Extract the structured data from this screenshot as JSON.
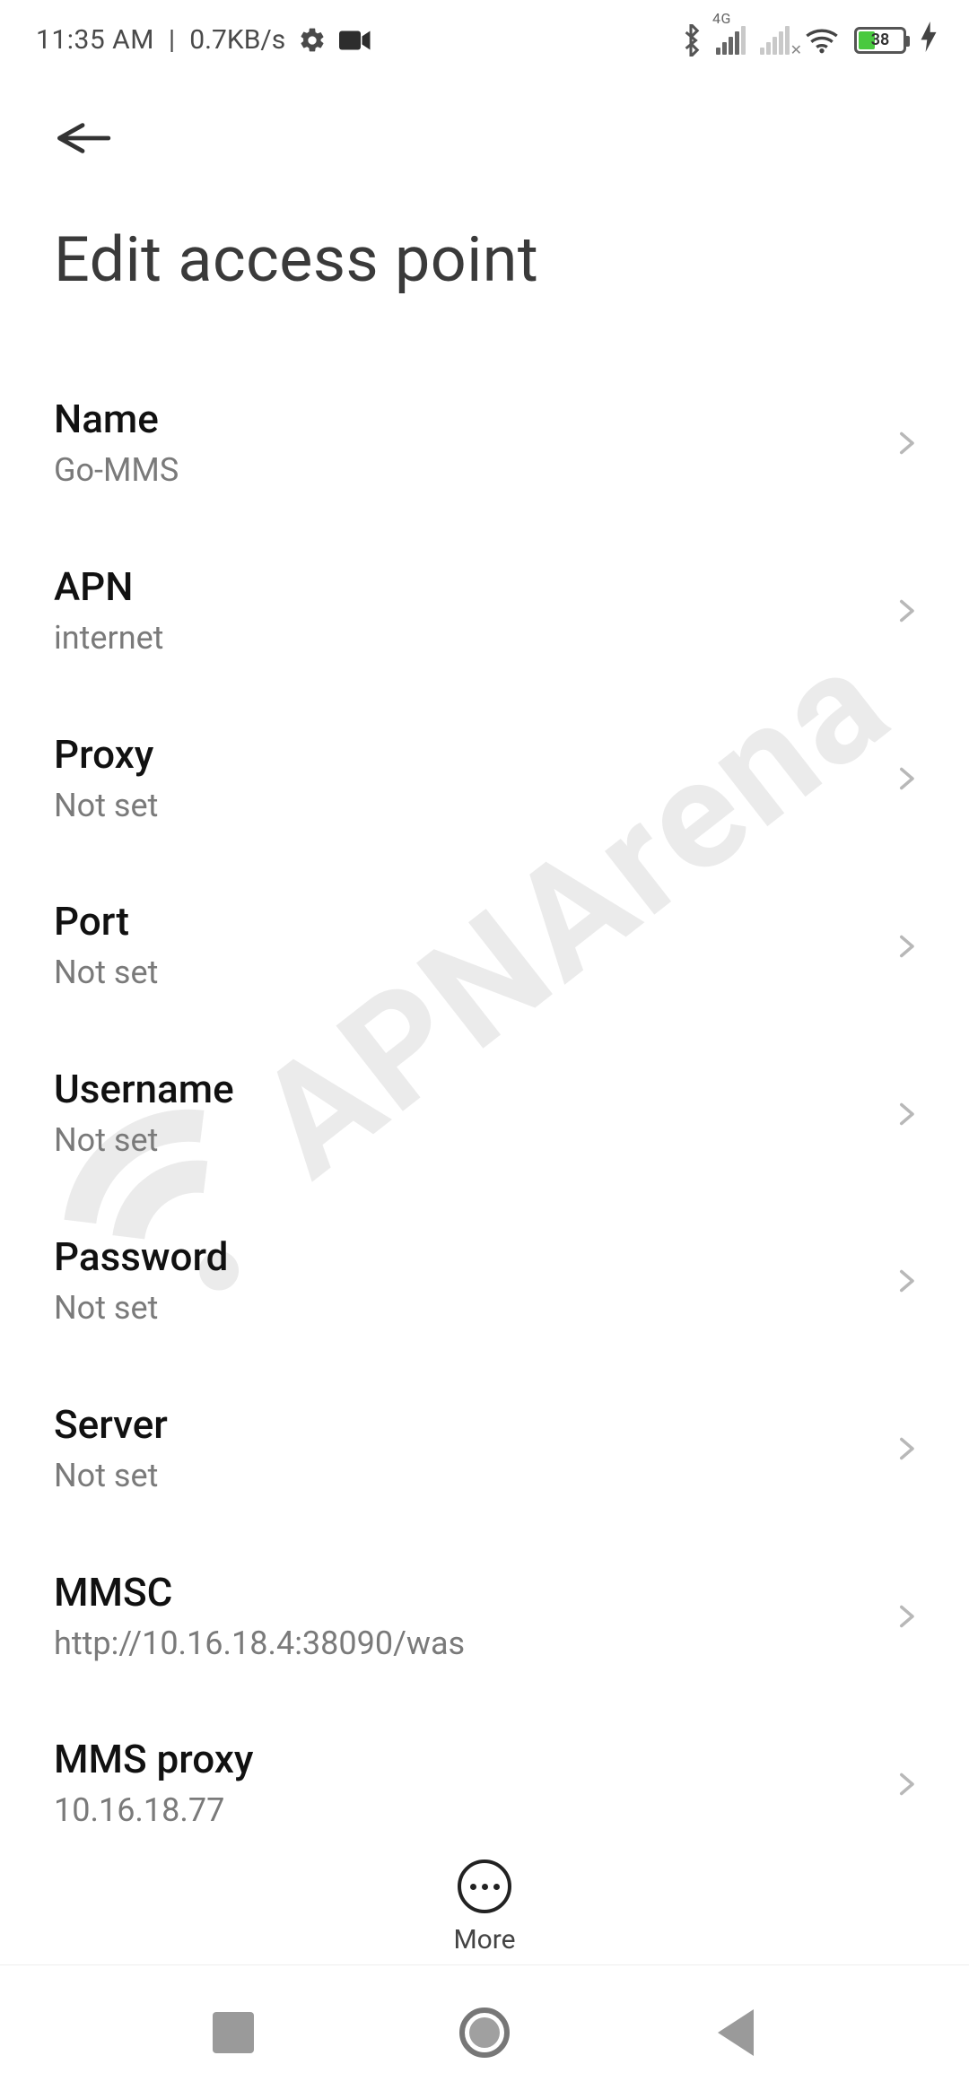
{
  "status": {
    "time": "11:35 AM",
    "net_speed": "0.7KB/s",
    "signal_gen": "4G",
    "battery_pct": 38
  },
  "page": {
    "title": "Edit access point"
  },
  "rows": [
    {
      "label": "Name",
      "value": "Go-MMS"
    },
    {
      "label": "APN",
      "value": "internet"
    },
    {
      "label": "Proxy",
      "value": "Not set"
    },
    {
      "label": "Port",
      "value": "Not set"
    },
    {
      "label": "Username",
      "value": "Not set"
    },
    {
      "label": "Password",
      "value": "Not set"
    },
    {
      "label": "Server",
      "value": "Not set"
    },
    {
      "label": "MMSC",
      "value": "http://10.16.18.4:38090/was"
    },
    {
      "label": "MMS proxy",
      "value": "10.16.18.77"
    }
  ],
  "more_label": "More",
  "watermark": "APNArena"
}
